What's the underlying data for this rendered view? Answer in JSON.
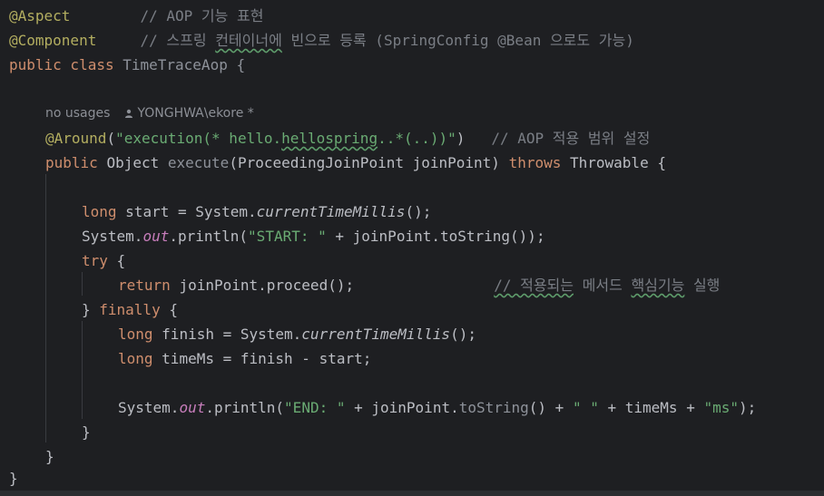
{
  "code": {
    "l1": {
      "annotation": "@Aspect",
      "comment": "// AOP 기능 표현"
    },
    "l2": {
      "annotation": "@Component",
      "comment": "// 스프링 ",
      "comment_typo": "컨테이너에",
      "comment_rest": " 빈으로 등록 (SpringConfig @Bean 으로도 가능)"
    },
    "l3": {
      "kw": "public class ",
      "name": "TimeTraceAop {"
    },
    "hint": {
      "usages": "no usages",
      "author": "YONGHWA\\ekore *"
    },
    "l4": {
      "annotation": "@Around",
      "p1": "(",
      "s1": "\"execution(* hello.",
      "s_typo": "hellospring",
      "s2": "..*(..))\"",
      "p2": ")",
      "comment": "// AOP 적용 범위 설정"
    },
    "l5": {
      "kw1": "public ",
      "t1": "Object ",
      "method": "execute",
      "p1": "(ProceedingJoinPoint joinPoint) ",
      "kw2": "throws ",
      "t2": "Throwable {"
    },
    "l6": {
      "kw": "long ",
      "t1": "start = System.",
      "m": "currentTimeMillis",
      "t2": "();"
    },
    "l7": {
      "t1": "System.",
      "f": "out",
      "t2": ".println(",
      "s": "\"START: \"",
      "t3": " + joinPoint.toString());"
    },
    "l8": {
      "kw": "try ",
      "t": "{"
    },
    "l9": {
      "kw": "return ",
      "t": "joinPoint.proceed();",
      "comment_typo1": "// 적용되는",
      "comment_mid": " 메서드 ",
      "comment_typo2": "핵심기능",
      "comment_rest": " 실행"
    },
    "l10": {
      "t1": "} ",
      "kw": "finally ",
      "t2": "{"
    },
    "l11": {
      "kw": "long ",
      "t1": "finish = System.",
      "m": "currentTimeMillis",
      "t2": "();"
    },
    "l12": {
      "kw": "long ",
      "t": "timeMs = finish - start;"
    },
    "l13": {
      "t1": "System.",
      "f": "out",
      "t2": ".println(",
      "s1": "\"END: \"",
      "t3": " + joinPoint.",
      "m": "toString",
      "t4": "() + ",
      "s2": "\" \"",
      "t5": " + timeMs + ",
      "s3": "\"ms\"",
      "t6": ");"
    },
    "l14": {
      "t": "}"
    },
    "l15": {
      "t": "}"
    },
    "l16": {
      "t": "}"
    }
  }
}
